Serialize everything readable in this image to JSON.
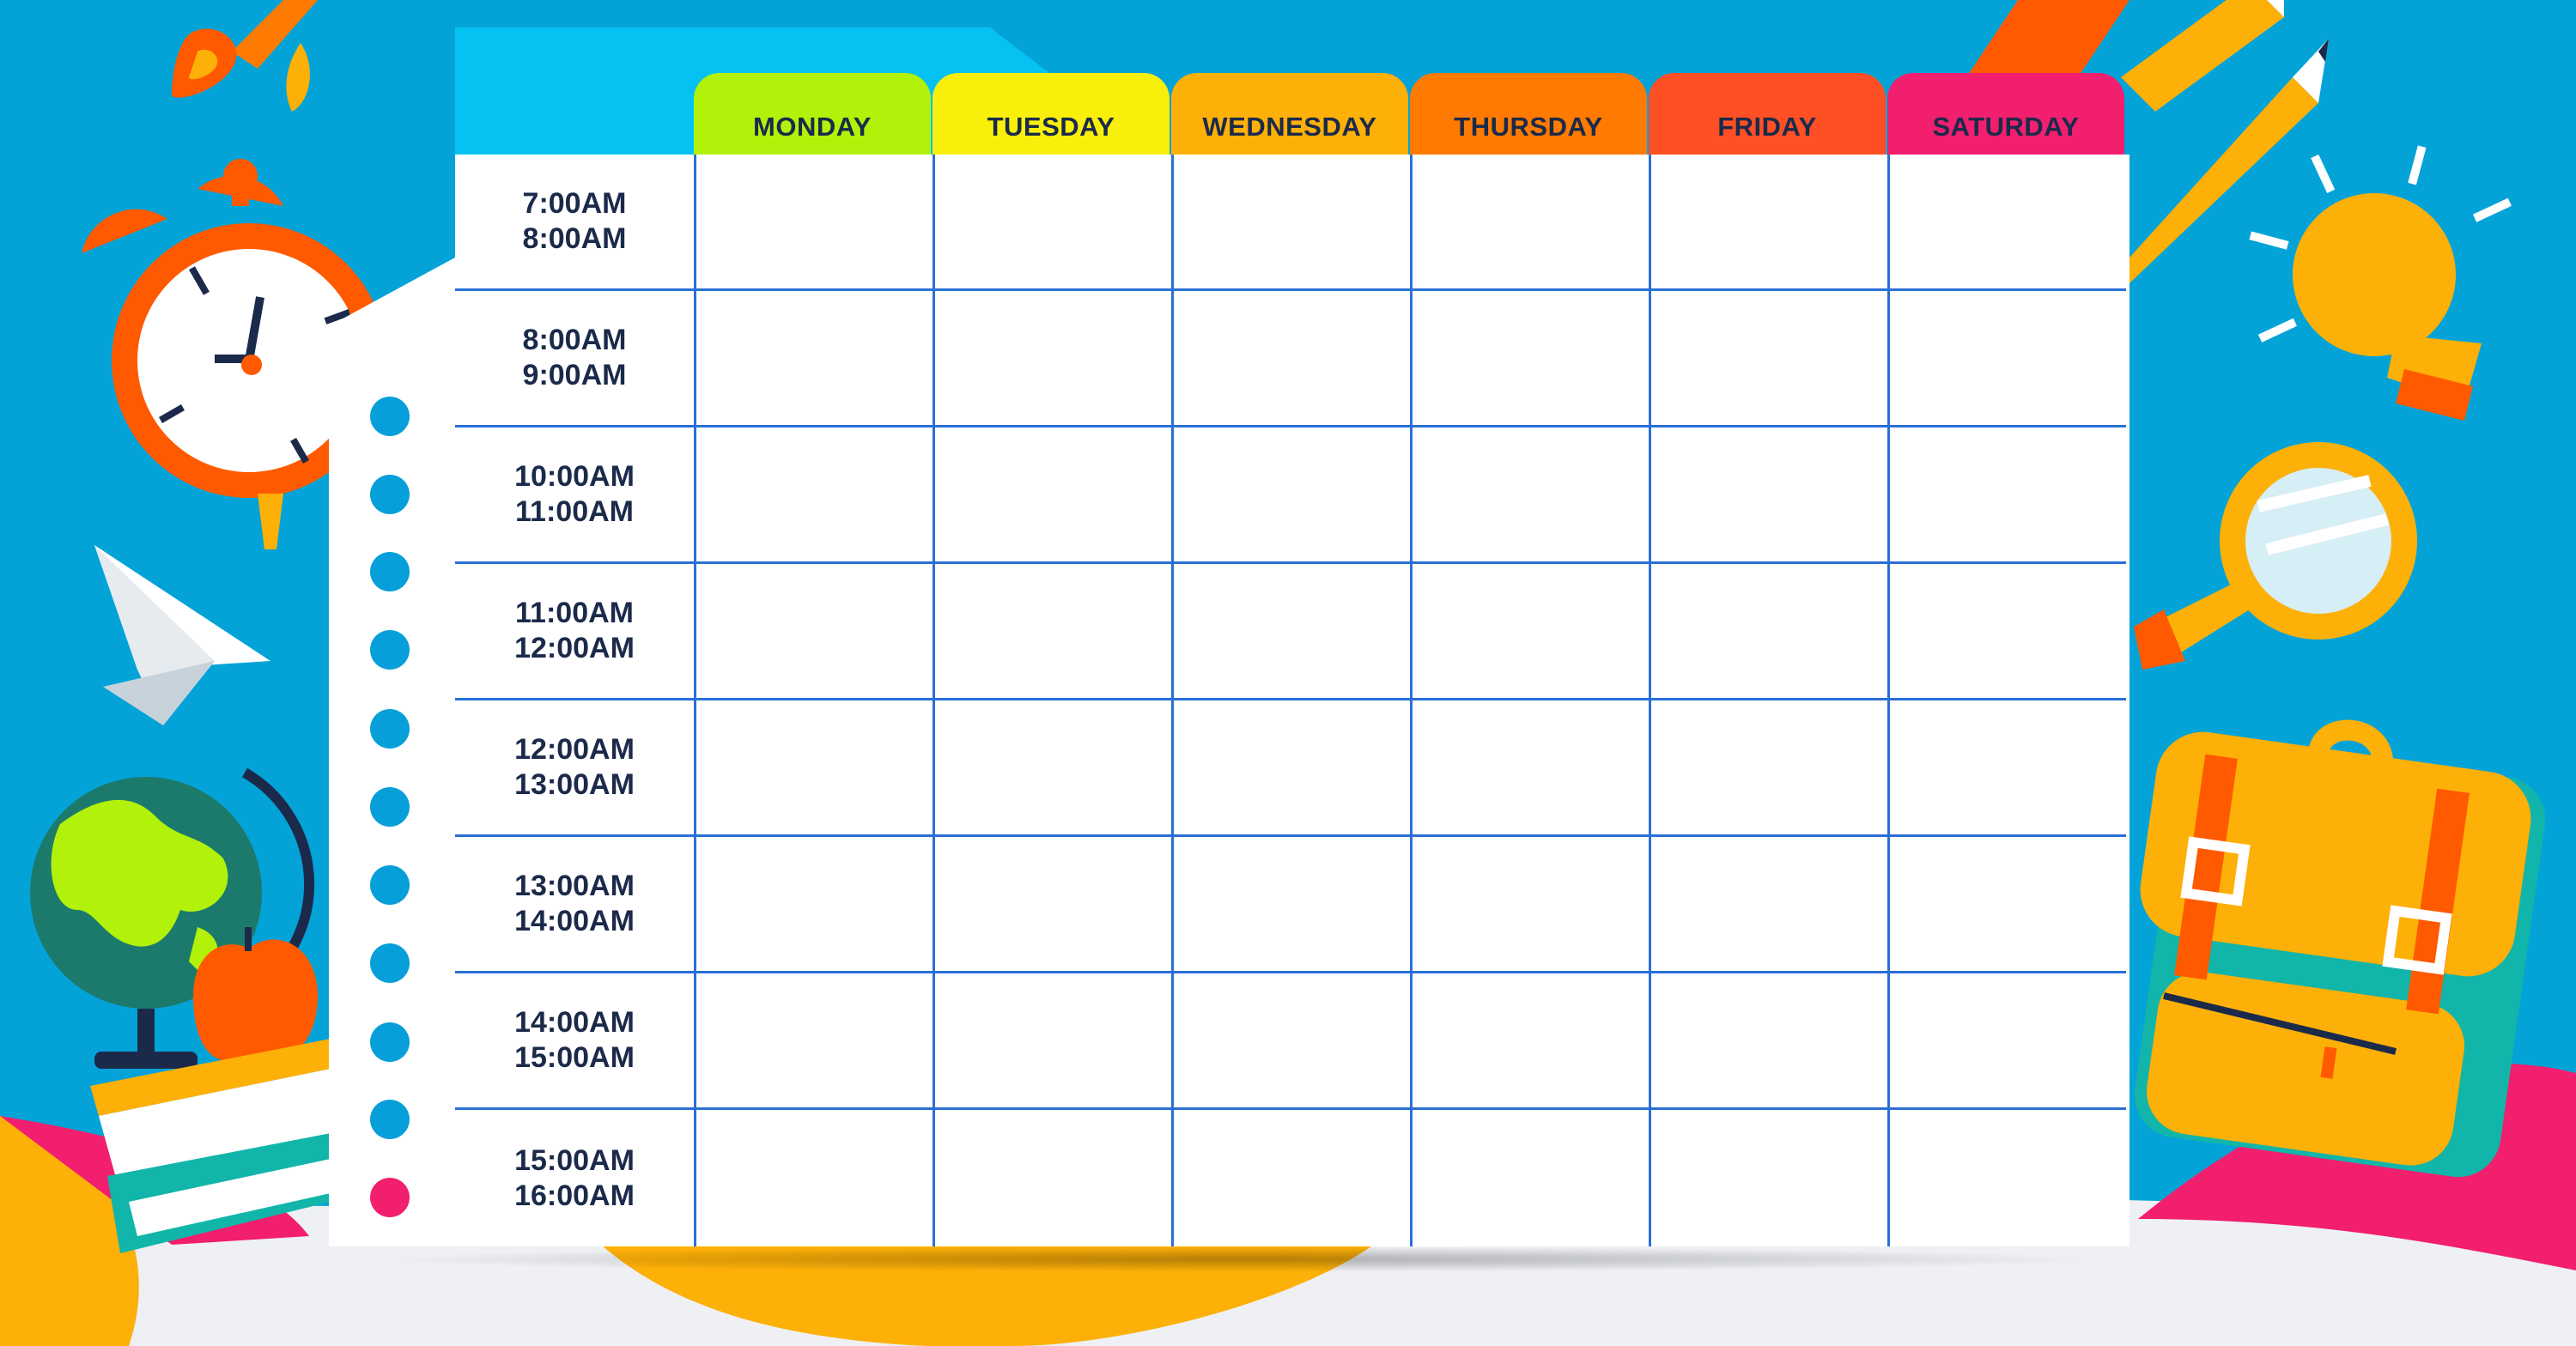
{
  "schedule": {
    "days": [
      "MONDAY",
      "TUESDAY",
      "WEDNESDAY",
      "THURSDAY",
      "FRIDAY",
      "SATURDAY"
    ],
    "day_colors": [
      "#b2f20a",
      "#f8f00a",
      "#fdb008",
      "#ff7a00",
      "#ff4f24",
      "#f21e6e"
    ],
    "time_slots": [
      {
        "start": "7:00AM",
        "end": "8:00AM"
      },
      {
        "start": "8:00AM",
        "end": "9:00AM"
      },
      {
        "start": "10:00AM",
        "end": "11:00AM"
      },
      {
        "start": "11:00AM",
        "end": "12:00AM"
      },
      {
        "start": "12:00AM",
        "end": "13:00AM"
      },
      {
        "start": "13:00AM",
        "end": "14:00AM"
      },
      {
        "start": "14:00AM",
        "end": "15:00AM"
      },
      {
        "start": "15:00AM",
        "end": "16:00AM"
      }
    ],
    "grid_line_color": "#2a6fd6"
  },
  "decorations": [
    "rocket-icon",
    "alarm-clock-icon",
    "paper-plane-icon",
    "globe-icon",
    "apple-icon",
    "books-icon",
    "ruler-icon",
    "pencil-icon",
    "light-bulb-icon",
    "magnifier-icon",
    "backpack-icon"
  ]
}
